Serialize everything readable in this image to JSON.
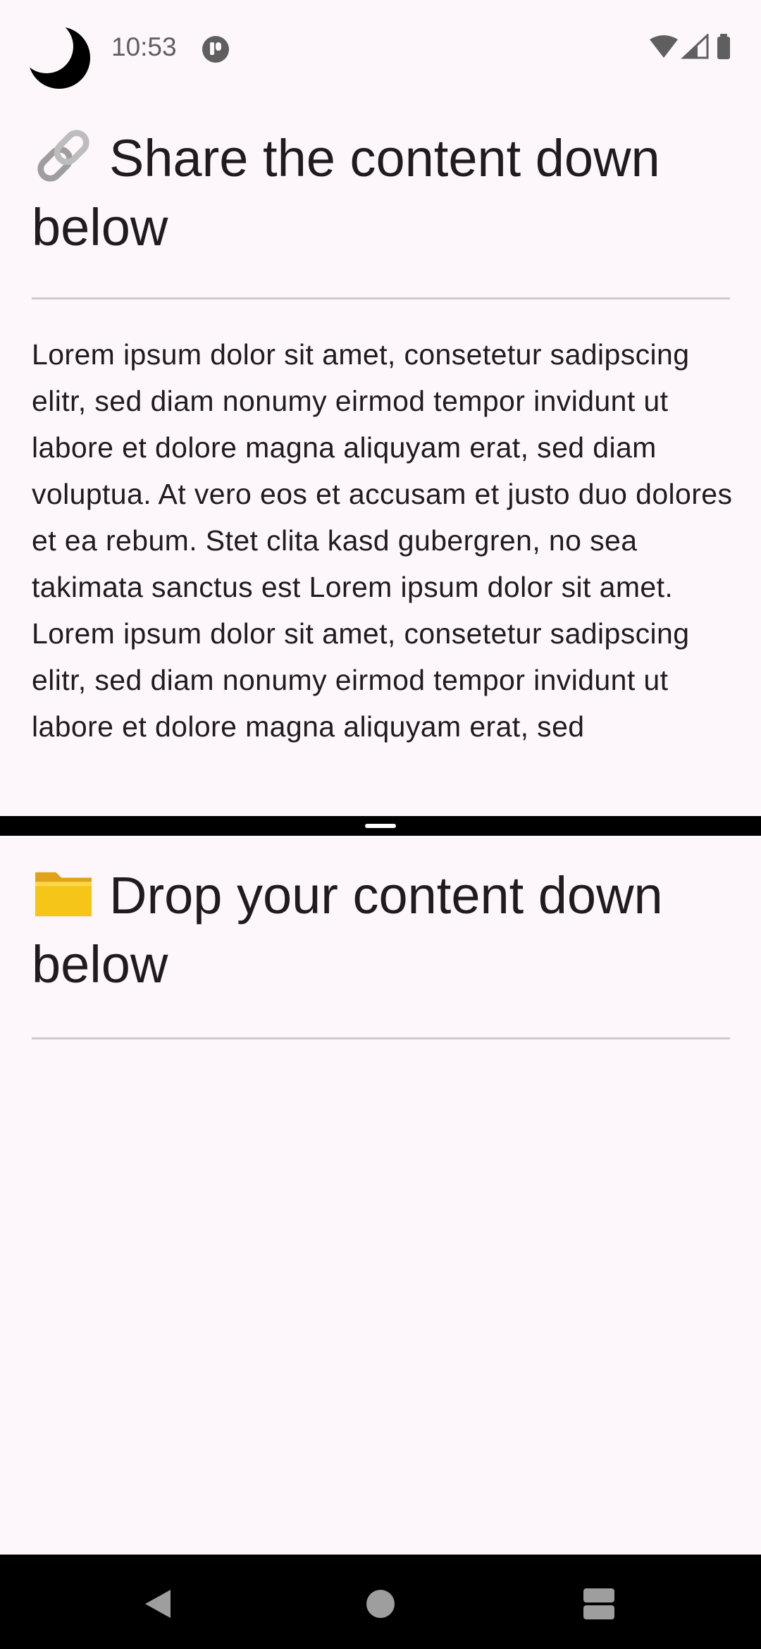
{
  "status_bar": {
    "time": "10:53",
    "icons": [
      "moon-icon",
      "notification-icon",
      "wifi-icon",
      "cellular-icon",
      "battery-icon"
    ]
  },
  "share_pane": {
    "emoji_icon": "link-icon",
    "title": "Share the content down below",
    "body": "Lorem ipsum dolor sit amet, consetetur sadipscing elitr, sed diam nonumy eirmod tempor invidunt ut labore et dolore magna aliquyam erat, sed diam voluptua. At vero eos et accusam et justo duo dolores et ea rebum. Stet clita kasd gubergren, no sea takimata sanctus est Lorem ipsum dolor sit amet. Lorem ipsum dolor sit amet, consetetur sadipscing elitr, sed diam nonumy eirmod tempor invidunt ut labore et dolore magna aliquyam erat, sed"
  },
  "drop_pane": {
    "emoji_icon": "folder-icon",
    "title": "Drop your content down below"
  },
  "nav_bar": {
    "buttons": [
      "back-icon",
      "home-icon",
      "recents-icon"
    ]
  },
  "colors": {
    "background": "#fdf7fb",
    "text": "#1f1b1f",
    "divider": "#cfc9cf",
    "bars": "#000000"
  }
}
